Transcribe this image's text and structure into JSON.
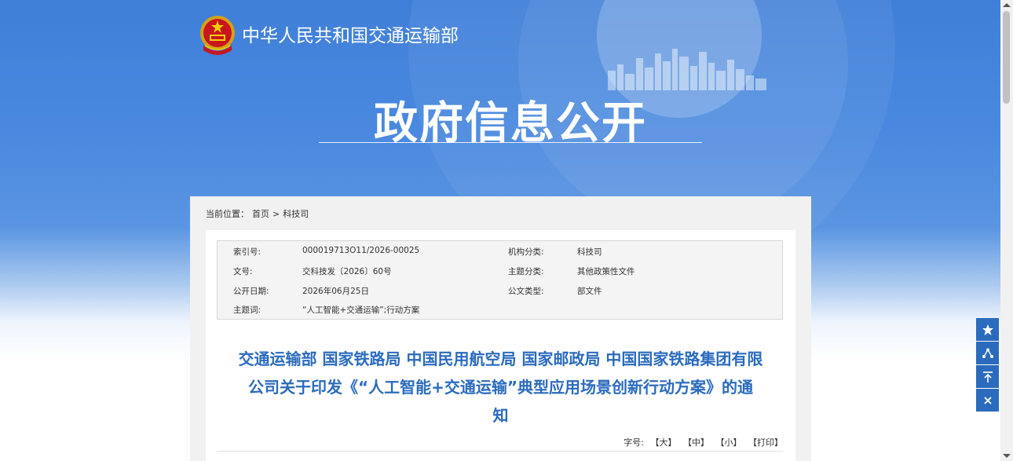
{
  "header": {
    "ministry_name": "中华人民共和国交通运输部",
    "section_title": "政府信息公开"
  },
  "breadcrumb": {
    "prefix": "当前位置：",
    "home": "首页",
    "separator": ">",
    "current": "科技司"
  },
  "meta": {
    "index_label": "索引号:",
    "index_value": "000019713O11/2026-00025",
    "org_label": "机构分类:",
    "org_value": "科技司",
    "docno_label": "文号:",
    "docno_value": "交科技发〔2026〕60号",
    "topic_label": "主题分类:",
    "topic_value": "其他政策性文件",
    "date_label": "公开日期:",
    "date_value": "2026年06月25日",
    "type_label": "公文类型:",
    "type_value": "部文件",
    "keyword_label": "主题词:",
    "keyword_value": "“人工智能+交通运输”;行动方案"
  },
  "document": {
    "title_line1": "交通运输部 国家铁路局 中国民用航空局 国家邮政局 中国国家铁路集团有限",
    "title_line2": "公司关于印发《“人工智能+交通运输”典型应用场景创新行动方案》的通",
    "title_line3": "知"
  },
  "font_controls": {
    "label": "字号:",
    "large": "【大】",
    "medium": "【中】",
    "small": "【小】",
    "print": "【打印】"
  },
  "side_tools": [
    "star-icon",
    "share-icon",
    "back-to-top-icon",
    "close-icon"
  ],
  "colors": {
    "brand_blue": "#2b6bbd",
    "header_blue": "#4a89df"
  }
}
